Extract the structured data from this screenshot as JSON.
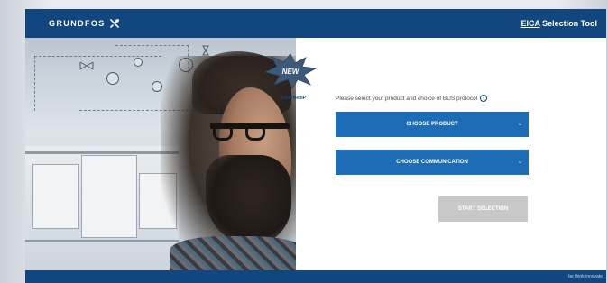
{
  "header": {
    "brand": "GRUNDFOS",
    "logo_icon": "grundfos-x-icon",
    "title_abbr": "EICA",
    "title_rest": " Selection Tool",
    "bg_color": "#12467e"
  },
  "badge": {
    "label": "NEW",
    "subtitle": "EtherNet/IP",
    "color": "#3e5a78"
  },
  "form": {
    "prompt": "Please select your product and choice of BUS protocol",
    "info_icon": "info-icon",
    "product_dropdown": "CHOOSE PRODUCT",
    "communication_dropdown": "CHOOSE COMMUNICATION",
    "dropdown_icon": "chevron-down-icon",
    "start_button": "START SELECTION",
    "dropdown_color": "#1c6cb6",
    "disabled_color": "#c8c8c8"
  },
  "footer": {
    "tagline": "be think innovate"
  }
}
